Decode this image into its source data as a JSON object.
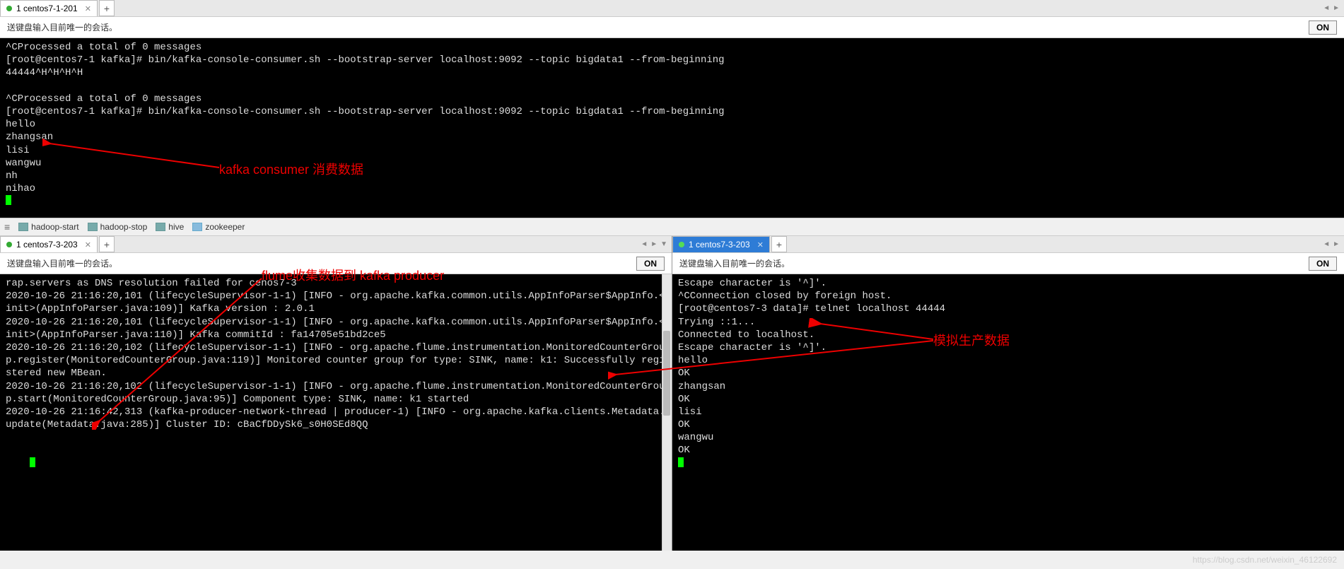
{
  "top": {
    "tab_label": "1 centos7-1-201",
    "info_text": "送键盘输入目前唯一的会话。",
    "on_label": "ON",
    "terminal_lines": [
      "^CProcessed a total of 0 messages",
      "[root@centos7-1 kafka]# bin/kafka-console-consumer.sh --bootstrap-server localhost:9092 --topic bigdata1 --from-beginning",
      "44444^H^H^H^H",
      "",
      "^CProcessed a total of 0 messages",
      "[root@centos7-1 kafka]# bin/kafka-console-consumer.sh --bootstrap-server localhost:9092 --topic bigdata1 --from-beginning",
      "hello",
      "zhangsan",
      "lisi",
      "wangwu",
      "nh",
      "nihao"
    ]
  },
  "toolbar": {
    "items": [
      "hadoop-start",
      "hadoop-stop",
      "hive",
      "zookeeper"
    ]
  },
  "left": {
    "tab_label": "1 centos7-3-203",
    "info_text": "送键盘输入目前唯一的会话。",
    "on_label": "ON",
    "terminal_lines": [
      "rap.servers as DNS resolution failed for cenos7-3",
      "2020-10-26 21:16:20,101 (lifecycleSupervisor-1-1) [INFO - org.apache.kafka.common.utils.AppInfoParser$AppInfo.<init>(AppInfoParser.java:109)] Kafka version : 2.0.1",
      "2020-10-26 21:16:20,101 (lifecycleSupervisor-1-1) [INFO - org.apache.kafka.common.utils.AppInfoParser$AppInfo.<init>(AppInfoParser.java:110)] Kafka commitId : fa14705e51bd2ce5",
      "2020-10-26 21:16:20,102 (lifecycleSupervisor-1-1) [INFO - org.apache.flume.instrumentation.MonitoredCounterGroup.register(MonitoredCounterGroup.java:119)] Monitored counter group for type: SINK, name: k1: Successfully registered new MBean.",
      "2020-10-26 21:16:20,102 (lifecycleSupervisor-1-1) [INFO - org.apache.flume.instrumentation.MonitoredCounterGroup.start(MonitoredCounterGroup.java:95)] Component type: SINK, name: k1 started",
      "2020-10-26 21:16:42,313 (kafka-producer-network-thread | producer-1) [INFO - org.apache.kafka.clients.Metadata.update(Metadata.java:285)] Cluster ID: cBaCfDDySk6_s0H0SEd8QQ"
    ]
  },
  "right": {
    "tab_label": "1 centos7-3-203",
    "info_text": "送键盘输入目前唯一的会话。",
    "on_label": "ON",
    "terminal_lines": [
      "Escape character is '^]'.",
      "^CConnection closed by foreign host.",
      "[root@centos7-3 data]# telnet localhost 44444",
      "Trying ::1...",
      "Connected to localhost.",
      "Escape character is '^]'.",
      "hello",
      "OK",
      "zhangsan",
      "OK",
      "lisi",
      "OK",
      "wangwu",
      "OK"
    ]
  },
  "annotations": {
    "top_label": "kafka consumer 消费数据",
    "left_label": "flume收集数据到 kafka producer",
    "right_label": "模拟生产数据"
  },
  "watermark": "https://blog.csdn.net/weixin_46122692"
}
